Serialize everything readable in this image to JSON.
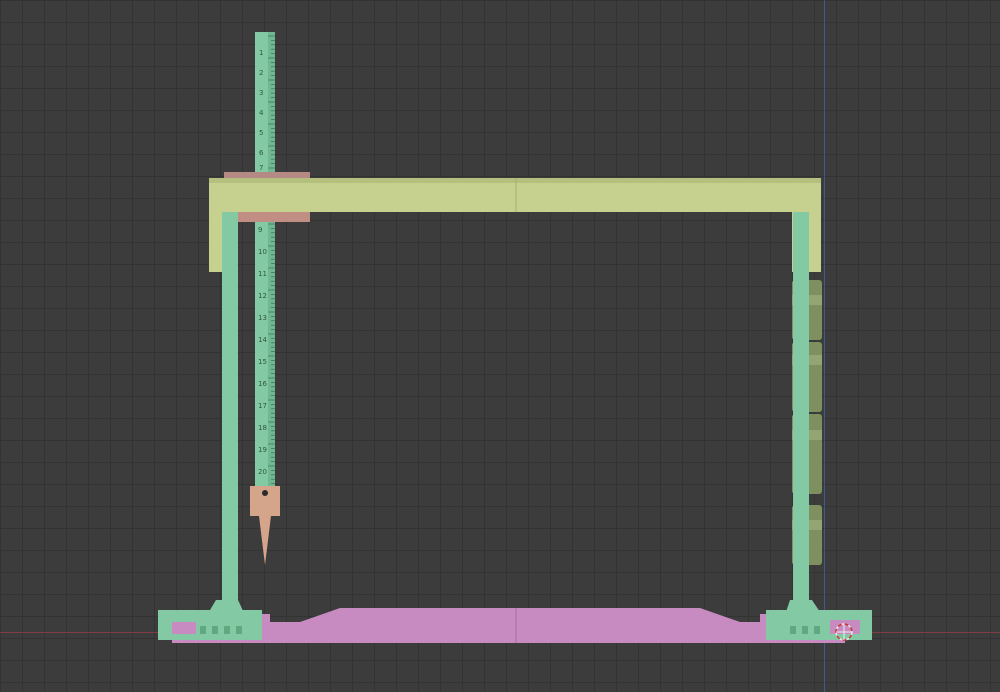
{
  "viewport": {
    "type": "3d-viewport-front-orthographic",
    "background": "#3c3c3c",
    "grid": true,
    "axis_colors": {
      "x": "#8a3a42",
      "z": "#3f5f9a"
    }
  },
  "model": {
    "parts": [
      {
        "name": "top-beam",
        "color": "#c6d08f"
      },
      {
        "name": "left-post",
        "color": "#82c9a4"
      },
      {
        "name": "right-post",
        "color": "#82c9a4"
      },
      {
        "name": "vertical-ruler",
        "color": "#82c9a4"
      },
      {
        "name": "ruler-slider-block",
        "color": "#d4a58a"
      },
      {
        "name": "scribe-pointer",
        "color": "#d4a58a"
      },
      {
        "name": "base-plate",
        "color": "#c78ac1"
      },
      {
        "name": "side-weights",
        "color": "#8f9f6a"
      }
    ],
    "ruler": {
      "upper_labels": [
        "1",
        "2",
        "3",
        "4",
        "5",
        "6",
        "7"
      ],
      "lower_labels": [
        "9",
        "10",
        "11",
        "12",
        "13",
        "14",
        "15",
        "16",
        "17",
        "18",
        "19",
        "20"
      ]
    }
  },
  "icons": {
    "origin_marker": "3d-cursor-icon"
  }
}
